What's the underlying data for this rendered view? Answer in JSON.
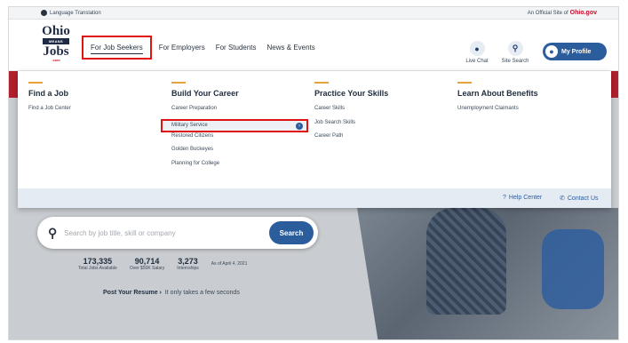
{
  "utility": {
    "language": "Language Translation",
    "official_prefix": "An Official Site of",
    "official_brand": "Ohio",
    "official_suffix": ".gov"
  },
  "logo": {
    "line1": "Ohio",
    "line2": "MEANS",
    "line3": "Jobs",
    "line4": ".com"
  },
  "nav": {
    "items": [
      {
        "label": "For Job Seekers",
        "active": true
      },
      {
        "label": "For Employers"
      },
      {
        "label": "For Students"
      },
      {
        "label": "News & Events"
      }
    ]
  },
  "header_actions": {
    "live_chat": "Live Chat",
    "site_search": "Site Search",
    "profile": "My Profile"
  },
  "mega_menu": {
    "columns": [
      {
        "heading": "Find a Job",
        "links": [
          "Find a Job Center"
        ]
      },
      {
        "heading": "Build Your Career",
        "links": [
          "Career Preparation",
          "Military Service",
          "Restored Citizens",
          "Golden Buckeyes",
          "Planning for College"
        ],
        "highlighted_index": 1
      },
      {
        "heading": "Practice Your Skills",
        "links": [
          "Career Skills",
          "Job Search Skills",
          "Career Path"
        ]
      },
      {
        "heading": "Learn About Benefits",
        "links": [
          "Unemployment Claimants"
        ]
      }
    ],
    "footer": {
      "help_center": "Help Center",
      "contact_us": "Contact Us"
    },
    "accent_color": "#e8a23b"
  },
  "search": {
    "placeholder": "Search by job title, skill or company",
    "button": "Search"
  },
  "stats": [
    {
      "value": "173,335",
      "label": "Total Jobs Available"
    },
    {
      "value": "90,714",
      "label": "Over $50K Salary"
    },
    {
      "value": "3,273",
      "label": "Internships"
    }
  ],
  "stats_as_of": "As of April 4, 2021",
  "resume": {
    "label": "Post Your Resume",
    "arrow": "›",
    "tagline": "It only takes a few seconds"
  },
  "colors": {
    "brand_blue": "#2b5d9c",
    "highlight_red": "#e01313",
    "ohio_red": "#c8102e"
  }
}
